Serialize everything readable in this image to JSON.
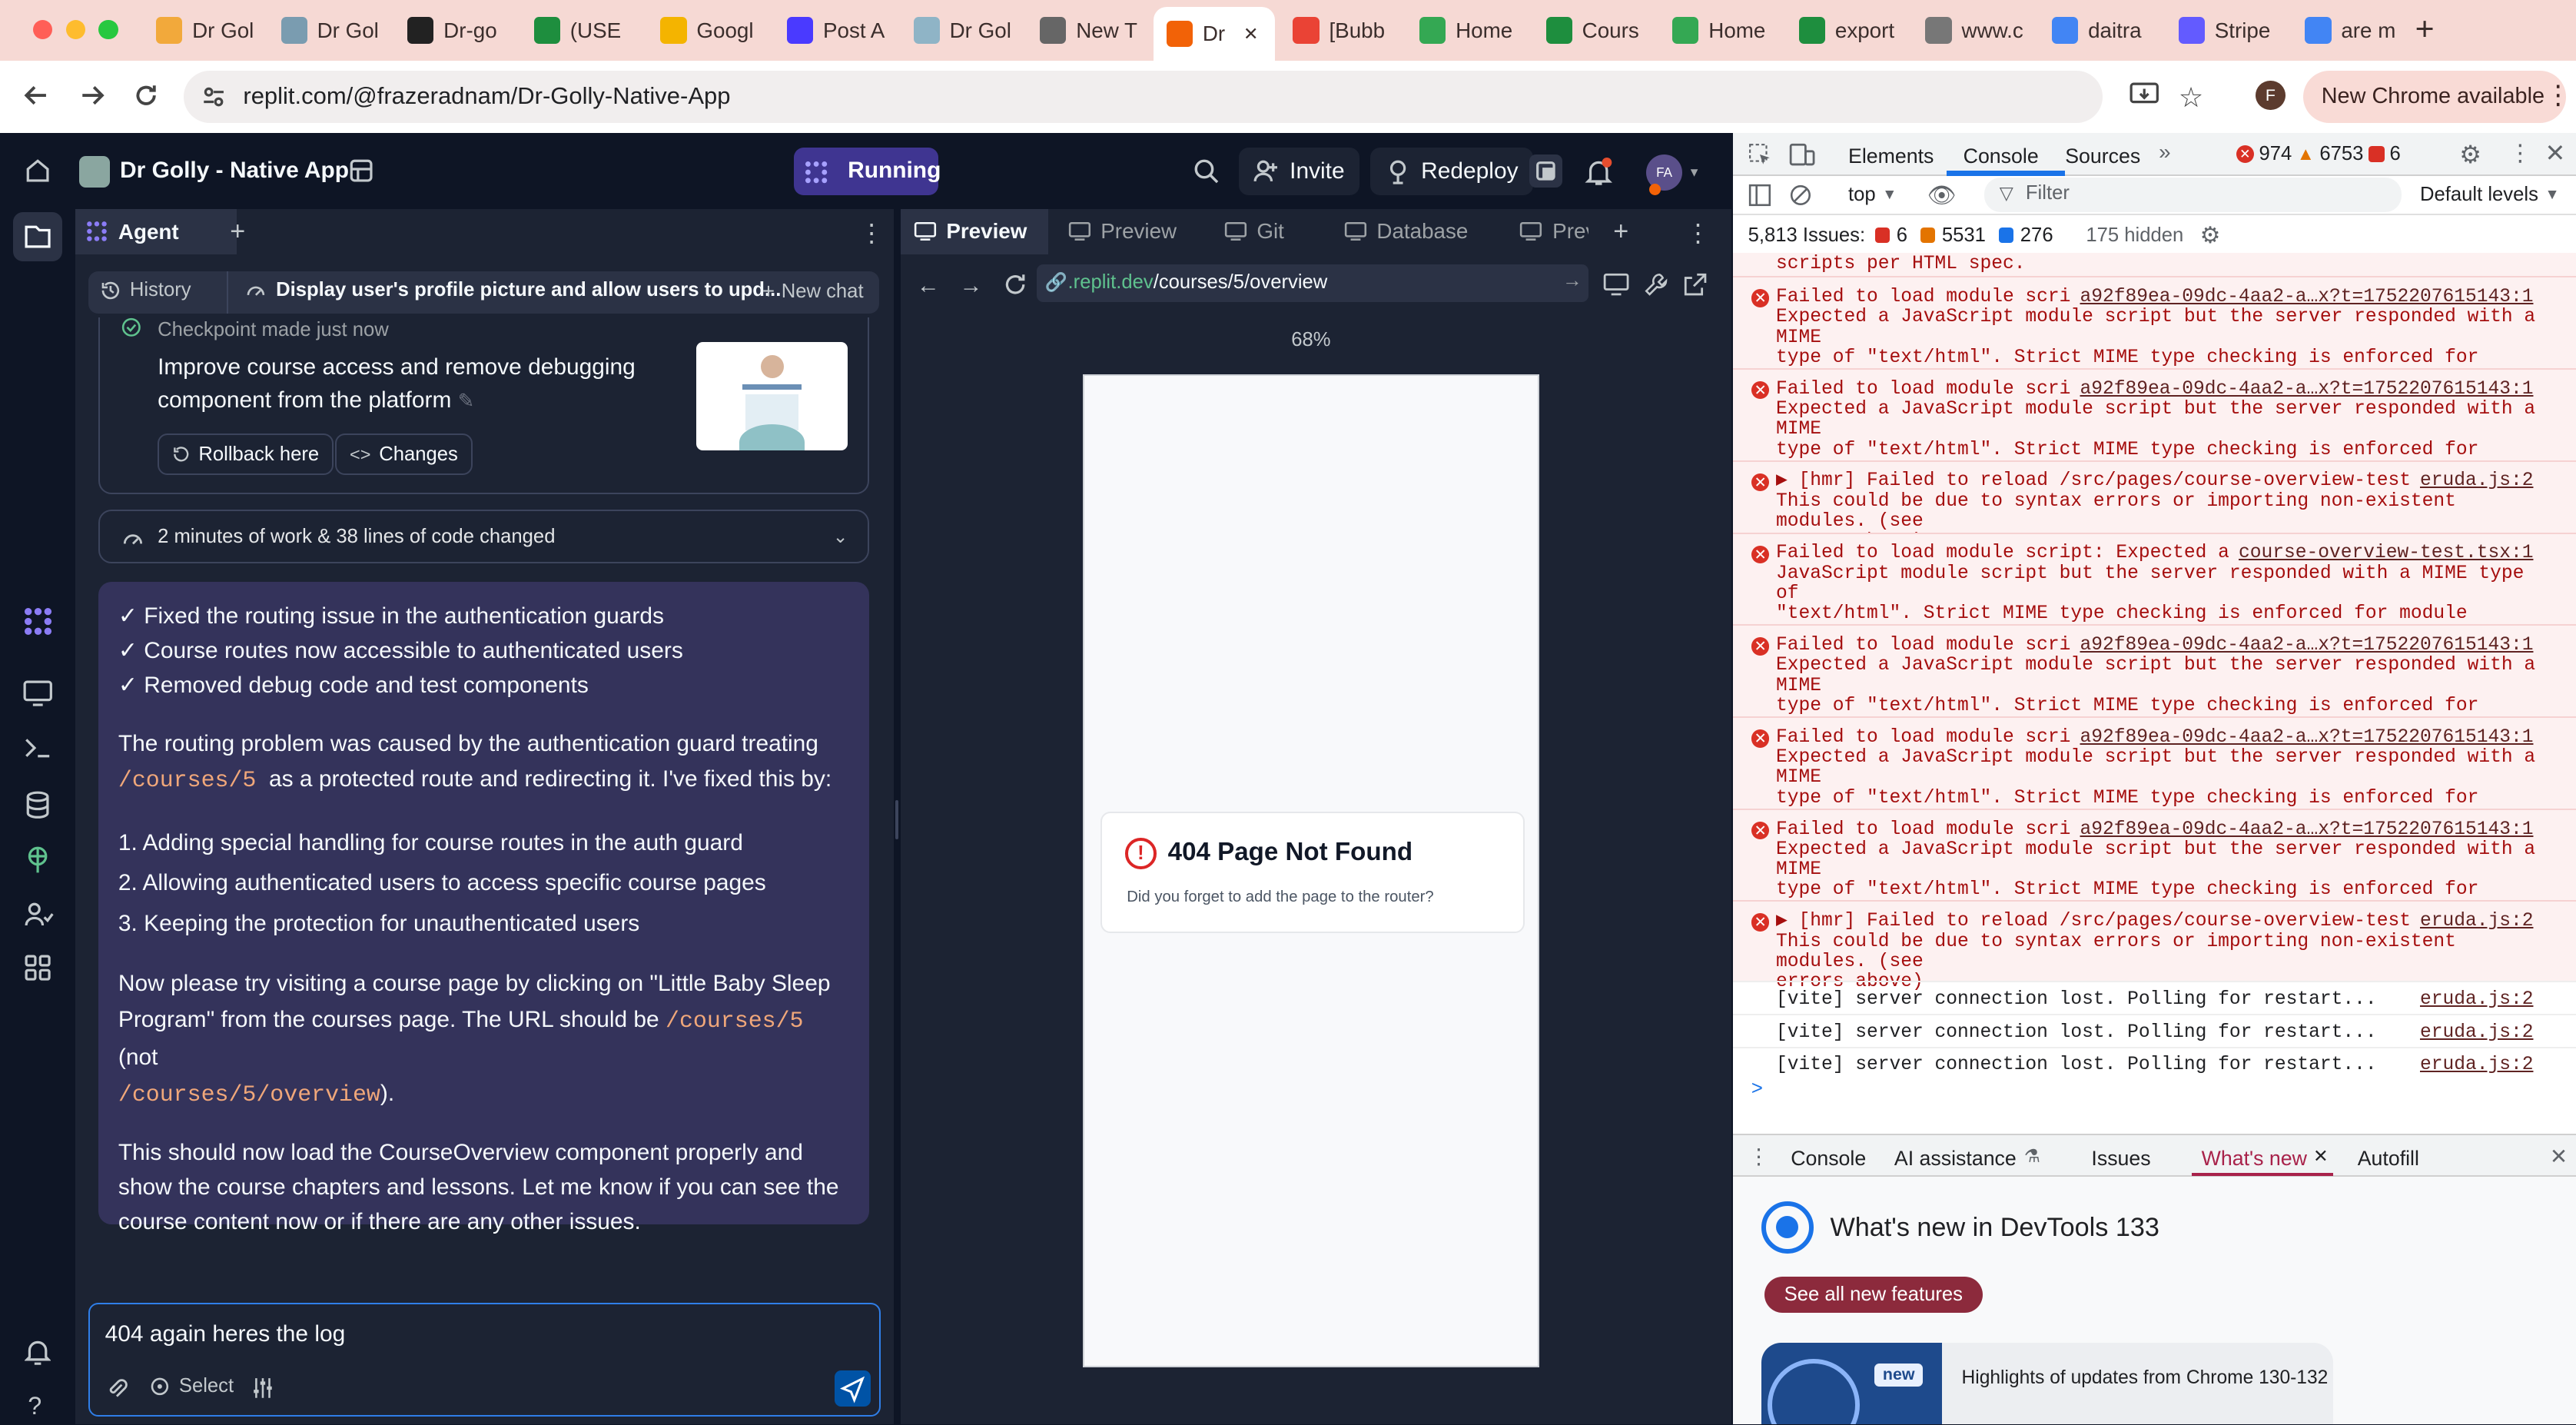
{
  "browser": {
    "tabs": [
      {
        "label": "Dr Gol",
        "color": "#f2a93b"
      },
      {
        "label": "Dr Gol",
        "color": "#7a9cb0"
      },
      {
        "label": "Dr-go",
        "color": "#222222"
      },
      {
        "label": "(USE",
        "color": "#1e8e3e"
      },
      {
        "label": "Googl",
        "color": "#f4b400"
      },
      {
        "label": "Post A",
        "color": "#4a3aff"
      },
      {
        "label": "Dr Gol",
        "color": "#8fb4c6"
      },
      {
        "label": "New T",
        "color": "#666666"
      },
      {
        "label": "Dr",
        "color": "#f26207",
        "active": true
      },
      {
        "label": "[Bubb",
        "color": "#ea4335"
      },
      {
        "label": "Home",
        "color": "#34a853"
      },
      {
        "label": "Cours",
        "color": "#1e8e3e"
      },
      {
        "label": "Home",
        "color": "#34a853"
      },
      {
        "label": "export",
        "color": "#1e8e3e"
      },
      {
        "label": "www.c",
        "color": "#777777"
      },
      {
        "label": "daitra",
        "color": "#4285f4"
      },
      {
        "label": "Stripe",
        "color": "#635bff"
      },
      {
        "label": "are m",
        "color": "#4285f4"
      }
    ],
    "new_tab_symbol": "+",
    "url": "replit.com/@frazeradnam/Dr-Golly-Native-App",
    "profile_initial": "F",
    "update_label": "New Chrome available"
  },
  "replit": {
    "project_name": "Dr Golly - Native App",
    "run_status": "Running",
    "invite_label": "Invite",
    "redeploy_label": "Redeploy",
    "avatar_initials": "FA"
  },
  "agent": {
    "tab_label": "Agent",
    "history_label": "History",
    "chat_title": "Display user's profile picture and allow users to upd...",
    "new_chat_label": "New chat",
    "checkpoint_label": "Checkpoint made just now",
    "checkpoint_text": "Improve course access and remove debugging component from the platform",
    "rollback_label": "Rollback here",
    "changes_label": "Changes",
    "work_summary": "2 minutes of work & 38 lines of code changed",
    "checklist": [
      "✓ Fixed the routing issue in the authentication guards",
      "✓ Course routes now accessible to authenticated users",
      "✓ Removed debug code and test components"
    ],
    "para1_pre": "The routing problem was caused by the authentication guard treating",
    "para1_code": "/courses/5",
    "para1_post": "as a protected route and redirecting it. I've fixed this by:",
    "steps": [
      "1. Adding special handling for course routes in the auth guard",
      "2. Allowing authenticated users to access specific course pages",
      "3. Keeping the protection for unauthenticated users"
    ],
    "para2_pre": "Now please try visiting a course page by clicking on \"Little Baby Sleep Program\" from the courses page. The URL should be",
    "para2_code1": "/courses/5",
    "para2_mid": "(not",
    "para2_code2": "/courses/5/overview",
    "para2_post": ").",
    "para3": "This should now load the CourseOverview component properly and show the course chapters and lessons. Let me know if you can see the course content now or if there are any other issues.",
    "input_value": "404 again heres the log",
    "select_label": "Select"
  },
  "preview": {
    "tabs": [
      "Preview",
      "Preview",
      "Git",
      "Database",
      "Previ"
    ],
    "url_domain": ".replit.dev",
    "url_path": "/courses/5/overview",
    "zoom": "68%",
    "error_title": "404 Page Not Found",
    "error_text": "Did you forget to add the page to the router?"
  },
  "devtools": {
    "tabs": [
      "Elements",
      "Console",
      "Sources"
    ],
    "error_count": "974",
    "warning_count": "6753",
    "issue_badge_count": "6",
    "context": "top",
    "filter_placeholder": "Filter",
    "levels": "Default levels",
    "issues_label": "5,813 Issues:",
    "issues_err": "6",
    "issues_warn": "5531",
    "issues_info": "276",
    "hidden_label": "175 hidden",
    "console_top": "scripts per HTML spec.",
    "messages": [
      {
        "text": "Failed to load module script:\nExpected a JavaScript module script but the server responded with a MIME\ntype of \"text/html\". Strict MIME type checking is enforced for module\nscripts per HTML spec.",
        "source": "a92f89ea-09dc-4aa2-a…x?t=1752207615143:1"
      },
      {
        "text": "Failed to load module script:\nExpected a JavaScript module script but the server responded with a MIME\ntype of \"text/html\". Strict MIME type checking is enforced for module\nscripts per HTML spec.",
        "source": "a92f89ea-09dc-4aa2-a…x?t=1752207615143:1"
      },
      {
        "text": "▶ [hmr] Failed to reload /src/pages/course-overview-test.tsx.\nThis could be due to syntax errors or importing non-existent modules. (see\nerrors above)",
        "source": "eruda.js:2"
      },
      {
        "text": "Failed to load module script: Expected a\nJavaScript module script but the server responded with a MIME type of\n\"text/html\". Strict MIME type checking is enforced for module scripts per\nHTML spec.",
        "source": "course-overview-test.tsx:1"
      },
      {
        "text": "Failed to load module script:\nExpected a JavaScript module script but the server responded with a MIME\ntype of \"text/html\". Strict MIME type checking is enforced for module\nscripts per HTML spec.",
        "source": "a92f89ea-09dc-4aa2-a…x?t=1752207615143:1"
      },
      {
        "text": "Failed to load module script:\nExpected a JavaScript module script but the server responded with a MIME\ntype of \"text/html\". Strict MIME type checking is enforced for module\nscripts per HTML spec.",
        "source": "a92f89ea-09dc-4aa2-a…x?t=1752207615143:1"
      },
      {
        "text": "Failed to load module script:\nExpected a JavaScript module script but the server responded with a MIME\ntype of \"text/html\". Strict MIME type checking is enforced for module\nscripts per HTML spec.",
        "source": "a92f89ea-09dc-4aa2-a…x?t=1752207615143:1"
      },
      {
        "text": "▶ [hmr] Failed to reload /src/pages/course-overview-test.tsx.\nThis could be due to syntax errors or importing non-existent modules. (see\nerrors above)",
        "source": "eruda.js:2"
      }
    ],
    "logs": [
      {
        "text": "[vite] server connection lost. Polling for restart...",
        "source": "eruda.js:2"
      },
      {
        "text": "[vite] server connection lost. Polling for restart...",
        "source": "eruda.js:2"
      },
      {
        "text": "[vite] server connection lost. Polling for restart...",
        "source": "eruda.js:2"
      }
    ],
    "prompt_symbol": ">",
    "drawer_tabs": [
      "Console",
      "AI assistance",
      "Issues",
      "What's new",
      "Autofill"
    ],
    "whatsnew_title": "What's new in DevTools 133",
    "see_all_label": "See all new features",
    "new_badge": "new",
    "highlights_label": "Highlights of updates from Chrome 130-132"
  }
}
